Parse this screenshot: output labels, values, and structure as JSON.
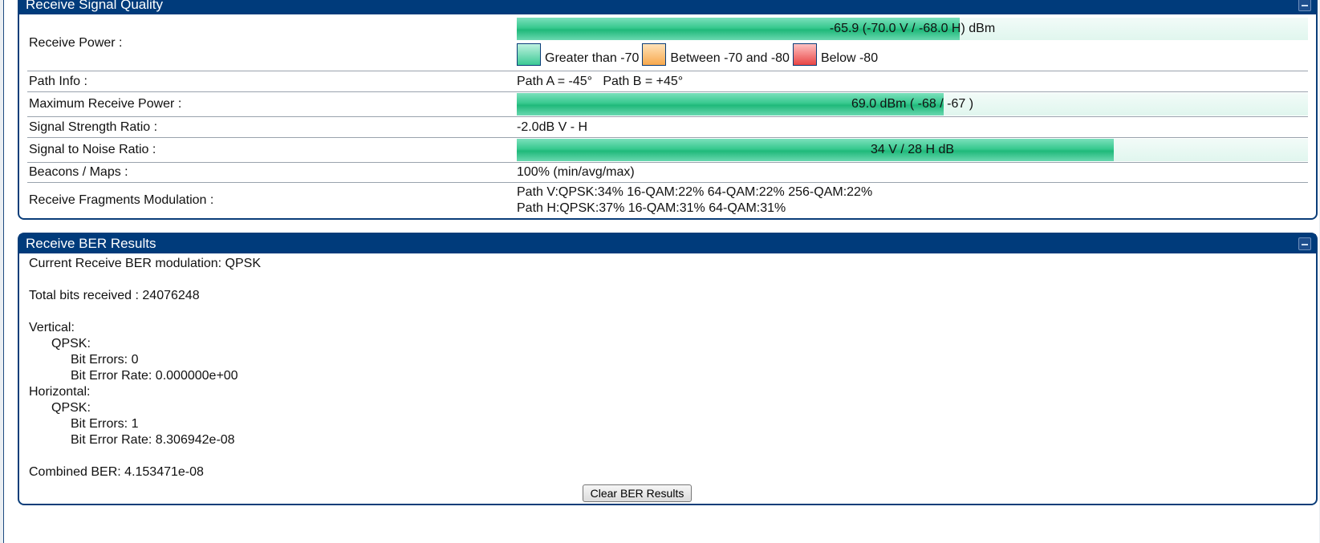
{
  "signal_quality": {
    "title": "Receive Signal Quality",
    "receive_power": {
      "label": "Receive Power :",
      "bar_text": "-65.9 (-70.0 V / -68.0 H) dBm",
      "bar_fill_fraction": 0.56
    },
    "legend": {
      "green": "Greater than -70",
      "orange": "Between -70 and -80",
      "red": "Below -80"
    },
    "path_info": {
      "label": "Path Info :",
      "value": "Path A = -45°   Path B = +45°"
    },
    "max_receive_power": {
      "label": "Maximum Receive Power :",
      "bar_text": "69.0 dBm ( -68 / -67 )",
      "bar_fill_fraction": 0.54
    },
    "signal_strength_ratio": {
      "label": "Signal Strength Ratio :",
      "value": "-2.0dB V - H"
    },
    "snr": {
      "label": "Signal to Noise Ratio :",
      "bar_text": "34 V / 28 H dB",
      "bar_fill_fraction": 0.755
    },
    "beacons": {
      "label": "Beacons / Maps :",
      "value": "100% (min/avg/max)"
    },
    "fragments": {
      "label": "Receive Fragments Modulation :",
      "path_v": "Path V:QPSK:34% 16-QAM:22% 64-QAM:22% 256-QAM:22%",
      "path_h": "Path H:QPSK:37% 16-QAM:31% 64-QAM:31%"
    }
  },
  "ber": {
    "title": "Receive BER Results",
    "current_modulation": "Current Receive BER modulation: QPSK",
    "total_bits": "Total bits received : 24076248",
    "vertical_label": "Vertical:",
    "v_mod": "QPSK:",
    "v_errors": "Bit Errors: 0",
    "v_rate": "Bit Error Rate: 0.000000e+00",
    "horizontal_label": "Horizontal:",
    "h_mod": "QPSK:",
    "h_errors": "Bit Errors: 1",
    "h_rate": "Bit Error Rate: 8.306942e-08",
    "combined": "Combined BER: 4.153471e-08",
    "clear_button": "Clear BER Results"
  }
}
